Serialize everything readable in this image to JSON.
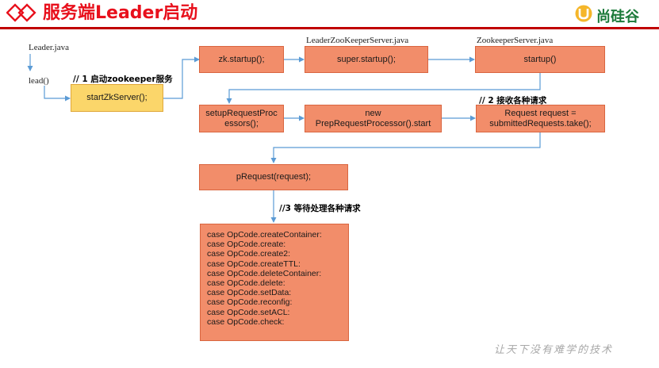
{
  "header": {
    "title": "服务端Leader启动",
    "brand": "尚硅谷"
  },
  "labels": {
    "leader_java": "Leader.java",
    "lead": "lead()",
    "leader_zk_server": "LeaderZooKeeperServer.java",
    "zk_server": "ZookeeperServer.java"
  },
  "notes": {
    "start_zk": "// 1 启动zookeeper服务",
    "receive": "// 2 接收各种请求",
    "process": "//3 等待处理各种请求"
  },
  "boxes": {
    "start_zk_server": "startZkServer();",
    "zk_startup": "zk.startup();",
    "super_startup": "super.startup();",
    "startup": "startup()",
    "setup_request_processors": "setupRequestProc essors();",
    "prep_processor_line1": "new",
    "prep_processor_line2": "PrepRequestProcessor().start",
    "request_line1": "Request request =",
    "request_line2": "submittedRequests.take();",
    "p_request": "pRequest(request);"
  },
  "code_lines": [
    "case OpCode.createContainer:",
    "case OpCode.create:",
    "case OpCode.create2:",
    "case OpCode.createTTL:",
    "case OpCode.deleteContainer:",
    "case OpCode.delete:",
    "case OpCode.setData:",
    "case OpCode.reconfig:",
    "case OpCode.setACL:",
    "case OpCode.check:"
  ],
  "footer": "让天下没有难学的技术",
  "colors": {
    "box_fill": "#f28d6a",
    "box_highlight": "#fbd66a",
    "connector": "#5b9bd5",
    "title": "#e8101c",
    "brand": "#1c7a3a"
  }
}
